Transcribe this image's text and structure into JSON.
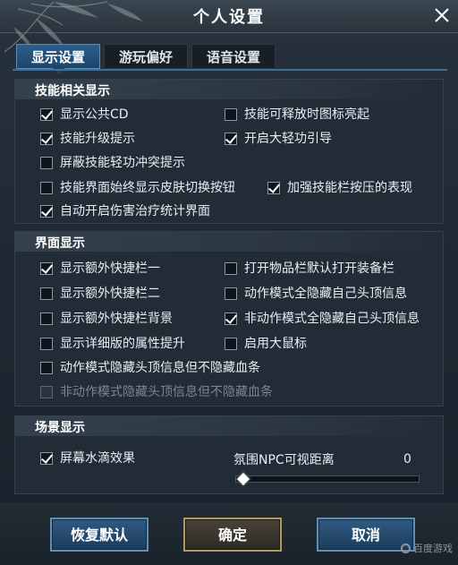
{
  "window": {
    "title": "个人设置"
  },
  "tabs": [
    {
      "label": "显示设置",
      "active": true
    },
    {
      "label": "游玩偏好",
      "active": false
    },
    {
      "label": "语音设置",
      "active": false
    }
  ],
  "sections": {
    "skill": {
      "title": "技能相关显示",
      "options": [
        {
          "label": "显示公共CD",
          "checked": true,
          "disabled": false
        },
        {
          "label": "技能可释放时图标亮起",
          "checked": false,
          "disabled": false
        },
        {
          "label": "技能升级提示",
          "checked": true,
          "disabled": false
        },
        {
          "label": "开启大轻功引导",
          "checked": true,
          "disabled": false
        },
        {
          "label": "屏蔽技能轻功冲突提示",
          "checked": false,
          "disabled": false
        },
        {
          "label": "技能界面始终显示皮肤切换按钮",
          "checked": false,
          "disabled": false
        },
        {
          "label": "加强技能栏按压的表现",
          "checked": true,
          "disabled": false
        },
        {
          "label": "自动开启伤害治疗统计界面",
          "checked": true,
          "disabled": false
        }
      ]
    },
    "ui": {
      "title": "界面显示",
      "options": [
        {
          "label": "显示额外快捷栏一",
          "checked": true,
          "disabled": false
        },
        {
          "label": "打开物品栏默认打开装备栏",
          "checked": false,
          "disabled": false
        },
        {
          "label": "显示额外快捷栏二",
          "checked": false,
          "disabled": false
        },
        {
          "label": "动作模式全隐藏自己头顶信息",
          "checked": false,
          "disabled": false
        },
        {
          "label": "显示额外快捷栏背景",
          "checked": false,
          "disabled": false
        },
        {
          "label": "非动作模式全隐藏自己头顶信息",
          "checked": true,
          "disabled": false
        },
        {
          "label": "显示详细版的属性提升",
          "checked": false,
          "disabled": false
        },
        {
          "label": "启用大鼠标",
          "checked": false,
          "disabled": false
        },
        {
          "label": "动作模式隐藏头顶信息但不隐藏血条",
          "checked": false,
          "disabled": false
        },
        {
          "label": "非动作模式隐藏头顶信息但不隐藏血条",
          "checked": false,
          "disabled": true
        }
      ]
    },
    "scene": {
      "title": "场景显示",
      "options": [
        {
          "label": "屏幕水滴效果",
          "checked": true,
          "disabled": false
        }
      ],
      "slider": {
        "label": "氛围NPC可视距离",
        "value": "0",
        "level": 0
      }
    }
  },
  "buttons": {
    "reset": "恢复默认",
    "confirm": "确定",
    "cancel": "取消"
  },
  "watermark": "百度游戏",
  "colors": {
    "accent_blue": "#2e5a82",
    "accent_gold": "#b59a5e",
    "panel_bg": "#222c36"
  }
}
